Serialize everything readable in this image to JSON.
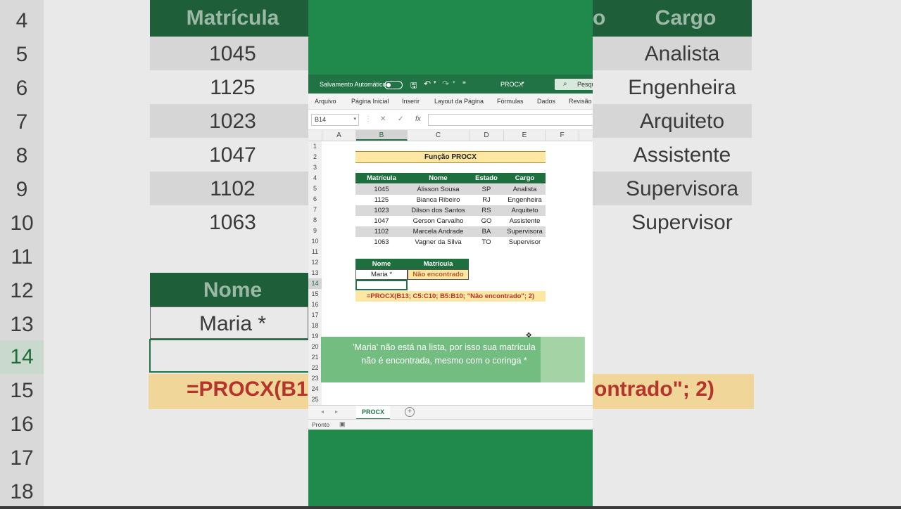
{
  "background": {
    "row_numbers": [
      "4",
      "5",
      "6",
      "7",
      "8",
      "9",
      "10",
      "11",
      "12",
      "13",
      "14",
      "15",
      "16",
      "17",
      "18"
    ],
    "header_left": "Matrícula",
    "header_right_fragment": "o",
    "header_right": "Cargo",
    "left_values": [
      "1045",
      "1125",
      "1023",
      "1047",
      "1102",
      "1063"
    ],
    "right_values": [
      "Analista",
      "Engenheira",
      "Arquiteto",
      "Assistente",
      "Supervisora",
      "Supervisor"
    ],
    "nome_header": "Nome",
    "nome_value": "Maria *",
    "formula_left": "=PROCX(B1",
    "formula_right": "ontrado\"; 2)"
  },
  "titlebar": {
    "autosave_label": "Salvamento Automático",
    "file_name": "PROCX",
    "search_placeholder": "Pesqu"
  },
  "ribbon": {
    "tabs": [
      "Arquivo",
      "Página Inicial",
      "Inserir",
      "Layout da Página",
      "Fórmulas",
      "Dados",
      "Revisão"
    ]
  },
  "formula_bar": {
    "name_box": "B14",
    "fx": "fx",
    "value": ""
  },
  "columns": [
    "A",
    "B",
    "C",
    "D",
    "E",
    "F"
  ],
  "rows": [
    "1",
    "2",
    "3",
    "4",
    "5",
    "6",
    "7",
    "8",
    "9",
    "10",
    "11",
    "12",
    "13",
    "14",
    "15",
    "16",
    "17",
    "18",
    "19",
    "20",
    "21",
    "22",
    "23",
    "24",
    "25"
  ],
  "sheet": {
    "title": "Função PROCX",
    "table_headers": [
      "Matrícula",
      "Nome",
      "Estado",
      "Cargo"
    ],
    "table_rows": [
      [
        "1045",
        "Álisson Sousa",
        "SP",
        "Analista"
      ],
      [
        "1125",
        "Bianca Ribeiro",
        "RJ",
        "Engenheira"
      ],
      [
        "1023",
        "Dilson dos Santos",
        "RS",
        "Arquiteto"
      ],
      [
        "1047",
        "Gerson Carvalho",
        "GO",
        "Assistente"
      ],
      [
        "1102",
        "Marcela Andrade",
        "BA",
        "Supervisora"
      ],
      [
        "1063",
        "Vagner da Silva",
        "TO",
        "Supervisor"
      ]
    ],
    "lookup_headers": [
      "Nome",
      "Matrícula"
    ],
    "lookup_name": "Maria *",
    "lookup_result": "Não encontrado",
    "formula_text": "=PROCX(B13; C5:C10; B5:B10; \"Não encontrado\"; 2)"
  },
  "caption": "'Maria' não está na lista, por isso sua matrícula não é encontrada, mesmo com o coringa *",
  "sheet_tabs": {
    "active": "PROCX"
  },
  "status": {
    "text": "Pronto"
  },
  "colors": {
    "excel_green": "#217346",
    "header_green": "#1f6e3d",
    "title_yellow": "#fde7a3",
    "formula_red": "#c0302a",
    "panel_green": "#1f8a4c"
  }
}
